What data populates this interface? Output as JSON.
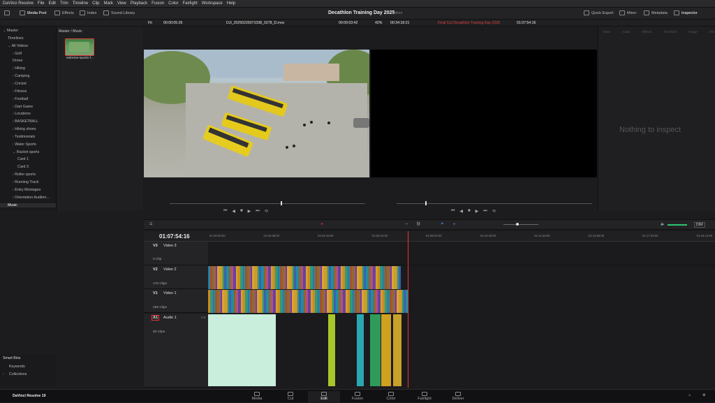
{
  "menu": [
    "DaVinci Resolve",
    "File",
    "Edit",
    "Trim",
    "Timeline",
    "Clip",
    "Mark",
    "View",
    "Playback",
    "Fusion",
    "Color",
    "Fairlight",
    "Workspace",
    "Help"
  ],
  "toolbar": {
    "media_pool": "Media Pool",
    "effects": "Effects",
    "index": "Index",
    "sound_library": "Sound Library",
    "project_title": "Decathlon Training Day 2025",
    "edited": "Edited",
    "quick_export": "Quick Export",
    "mixer": "Mixer",
    "metadata": "Metadata",
    "inspector": "Inspector"
  },
  "source_viewer": {
    "fit": "Fit",
    "timecode_in": "00:00:05:26",
    "clip_name": "DJI_20250226071038_0278_D.mov",
    "duration": "00:00:03:42"
  },
  "timeline_viewer": {
    "zoom": "42%",
    "duration": "00:34:18:21",
    "timeline_name": "Final Cut Decathlon Training Day 2025",
    "timecode": "01:07:54:16"
  },
  "breadcrumb": "Master / Music",
  "bins": [
    {
      "label": "Master",
      "depth": 0,
      "arrow": "⌄"
    },
    {
      "label": "Timelines",
      "depth": 1,
      "arrow": ""
    },
    {
      "label": "All Videos",
      "depth": 1,
      "arrow": "⌄"
    },
    {
      "label": "Golf",
      "depth": 2,
      "arrow": "›"
    },
    {
      "label": "Drone",
      "depth": 2,
      "arrow": ""
    },
    {
      "label": "Hiking",
      "depth": 2,
      "arrow": "›"
    },
    {
      "label": "Camping",
      "depth": 2,
      "arrow": "›"
    },
    {
      "label": "Cricket",
      "depth": 2,
      "arrow": "›"
    },
    {
      "label": "Fitness",
      "depth": 2,
      "arrow": "›"
    },
    {
      "label": "Football",
      "depth": 2,
      "arrow": "›"
    },
    {
      "label": "Dart Game",
      "depth": 2,
      "arrow": "›"
    },
    {
      "label": "Locations",
      "depth": 2,
      "arrow": "›"
    },
    {
      "label": "BASKETBALL",
      "depth": 2,
      "arrow": "›"
    },
    {
      "label": "Hiking shoes",
      "depth": 2,
      "arrow": "›"
    },
    {
      "label": "Testimonials",
      "depth": 2,
      "arrow": "›"
    },
    {
      "label": "Water Sports",
      "depth": 2,
      "arrow": "›"
    },
    {
      "label": "Racket sports",
      "depth": 2,
      "arrow": "⌄"
    },
    {
      "label": "Card 1",
      "depth": 3,
      "arrow": ""
    },
    {
      "label": "Card 3",
      "depth": 3,
      "arrow": ""
    },
    {
      "label": "Roller sports",
      "depth": 2,
      "arrow": "›"
    },
    {
      "label": "Running Track",
      "depth": 2,
      "arrow": "›"
    },
    {
      "label": "Entry Montages",
      "depth": 2,
      "arrow": "›"
    },
    {
      "label": "Orientation Auditori...",
      "depth": 2,
      "arrow": "›"
    },
    {
      "label": "Music",
      "depth": 1,
      "arrow": "",
      "selected": true
    }
  ],
  "smart_bins": {
    "title": "Smart Bins",
    "items": [
      "Keywords",
      "Collections"
    ]
  },
  "clip_thumb": {
    "label": "extreme-sports-f..."
  },
  "inspector": {
    "tabs": [
      "Video",
      "Audio",
      "Effects",
      "Transition",
      "Image",
      "File"
    ],
    "empty": "Nothing to inspect"
  },
  "timeline": {
    "timecode": "01:07:54:16",
    "ruler": [
      "01:00:00:00",
      "01:02:08:00",
      "01:04:16:00",
      "01:06:24:00",
      "01:08:32:00",
      "01:10:40:00",
      "01:12:48:00",
      "01:14:56:00",
      "01:17:04:00",
      "01:19:12:00"
    ],
    "tracks": [
      {
        "id": "V3",
        "name": "Video 3",
        "clips": "0 Clip"
      },
      {
        "id": "V2",
        "name": "Video 2",
        "clips": "170 Clips"
      },
      {
        "id": "V1",
        "name": "Video 1",
        "clips": "258 Clips"
      },
      {
        "id": "A1",
        "name": "Audio 1",
        "level": "2.0",
        "clips": "60 Clips"
      }
    ],
    "dim": "DIM"
  },
  "pages": [
    "Media",
    "Cut",
    "Edit",
    "Fusion",
    "Color",
    "Fairlight",
    "Deliver"
  ],
  "active_page": "Edit",
  "brand": "DaVinci Resolve 19",
  "colors": {
    "accent": "#e33b3b",
    "clip_teal": "#1f8ea0",
    "clip_orange": "#d0891f",
    "audio_green": "#bfe8d4"
  }
}
